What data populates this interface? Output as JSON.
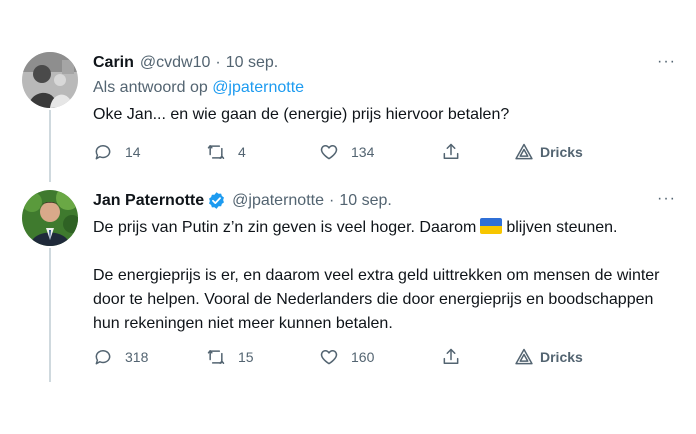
{
  "tweet1": {
    "name": "Carin",
    "handle": "@cvdw10",
    "separator": "·",
    "date": "10 sep.",
    "more": "···",
    "reply_prefix": "Als antwoord op ",
    "reply_mention": "@jpaternotte",
    "text": "Oke Jan... en wie gaan de (energie) prijs hiervoor betalen?",
    "replies": "14",
    "retweets": "4",
    "likes": "134",
    "dricks": "Dricks"
  },
  "tweet2": {
    "name": "Jan Paternotte",
    "handle": "@jpaternotte",
    "separator": "·",
    "date": "10 sep.",
    "more": "···",
    "text_p1_before": "De prijs van Putin z’n zin geven is veel hoger. Daarom",
    "text_p1_after": "blijven steunen.",
    "text_p2": "De energieprijs is er, en daarom veel extra geld uittrekken om mensen de winter door te helpen. Vooral de Nederlanders die door energieprijs en boodschappen hun rekeningen niet meer kunnen betalen.",
    "replies": "318",
    "retweets": "15",
    "likes": "160",
    "dricks": "Dricks"
  },
  "colors": {
    "text": "#0f1419",
    "secondary": "#536471",
    "link": "#1d9bf0",
    "thread_line": "#cfd9de",
    "verified": "#1d9bf0",
    "flag_blue": "#2f6fd6",
    "flag_yellow": "#f7c600"
  },
  "icons": [
    "reply-icon",
    "retweet-icon",
    "like-icon",
    "share-icon",
    "dricks-icon",
    "verified-badge-icon",
    "ukraine-flag-icon",
    "more-icon"
  ]
}
